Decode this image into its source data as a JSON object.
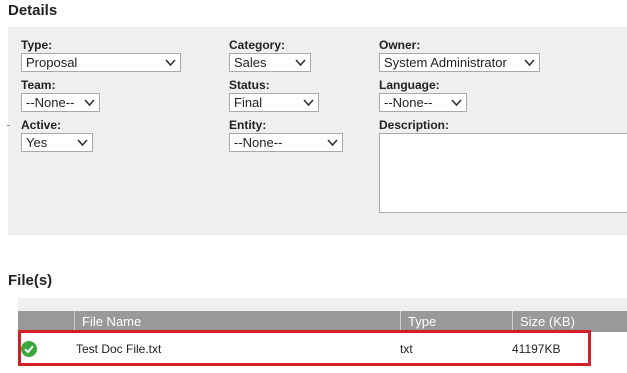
{
  "details": {
    "title": "Details",
    "fields": {
      "type": {
        "label": "Type:",
        "value": "Proposal"
      },
      "category": {
        "label": "Category:",
        "value": "Sales"
      },
      "owner": {
        "label": "Owner:",
        "value": "System Administrator"
      },
      "team": {
        "label": "Team:",
        "value": "--None--"
      },
      "status": {
        "label": "Status:",
        "value": "Final"
      },
      "language": {
        "label": "Language:",
        "value": "--None--"
      },
      "active": {
        "label": "Active:",
        "value": "Yes"
      },
      "entity": {
        "label": "Entity:",
        "value": "--None--"
      },
      "description": {
        "label": "Description:",
        "value": ""
      }
    }
  },
  "files": {
    "title": "File(s)",
    "columns": [
      "File Name",
      "Type",
      "Size (KB)"
    ],
    "rows": [
      {
        "status_icon": "check-circle-icon",
        "name": "Test Doc File.txt",
        "type": "txt",
        "size": "41197KB"
      }
    ]
  },
  "colors": {
    "panel_bg": "#efefef",
    "table_header_bg": "#999999",
    "highlight_border": "#d21f2a",
    "success_green": "#3aa83a"
  }
}
